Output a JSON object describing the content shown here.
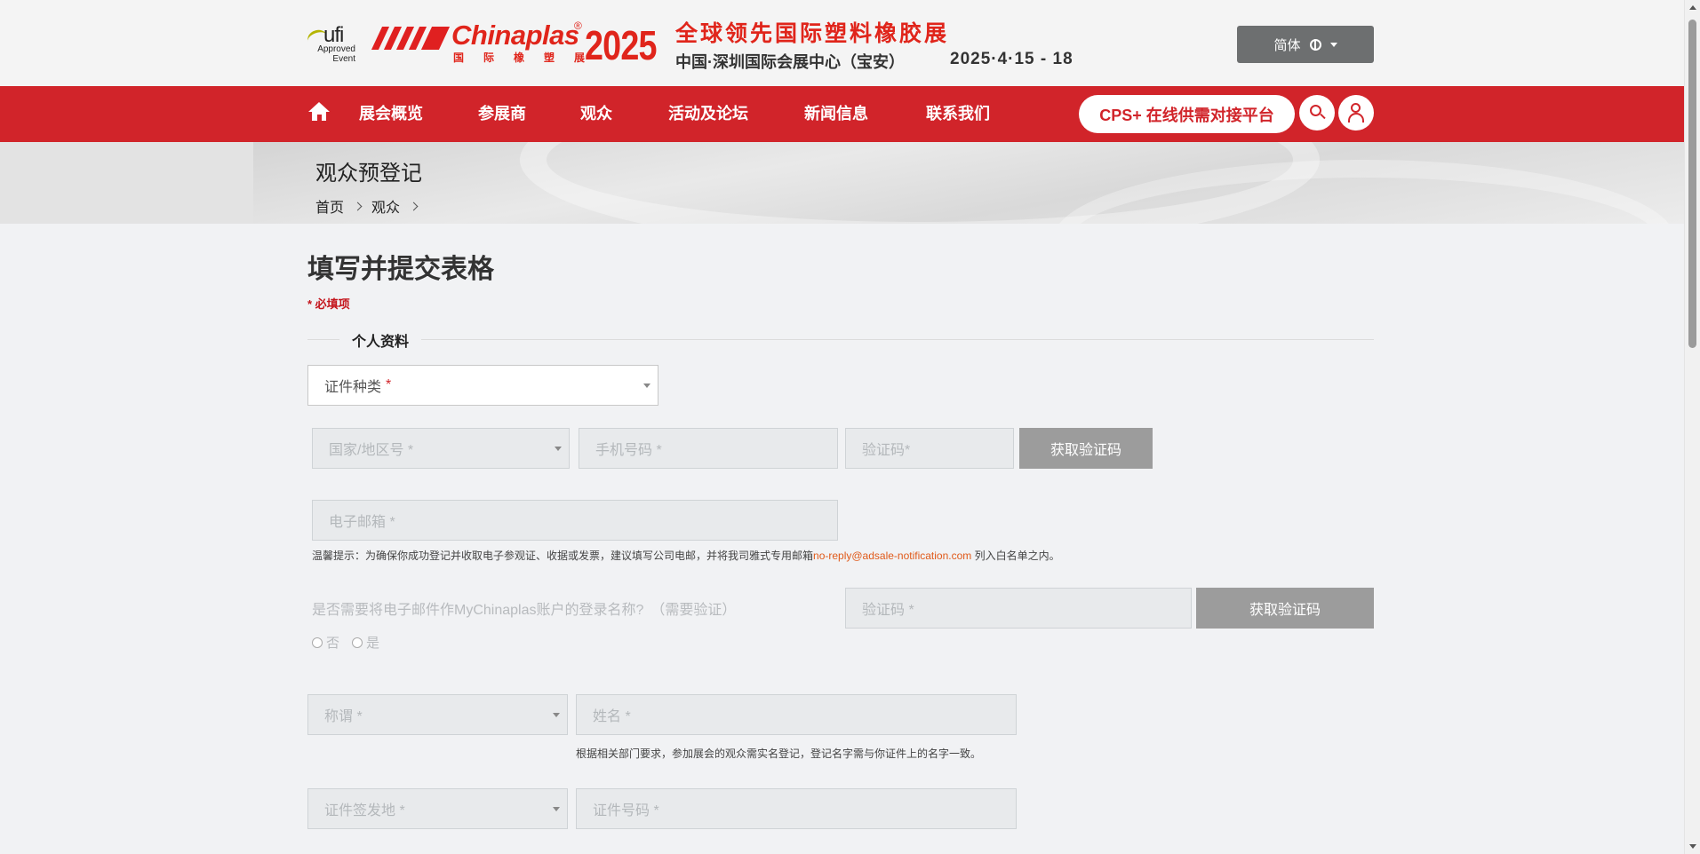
{
  "header": {
    "ufi": {
      "mark": "ufi",
      "sub": "Approved Event"
    },
    "logo": {
      "brand": "Chinaplas",
      "reg": "®",
      "year": "2025",
      "cn_small": "国际橡塑展"
    },
    "tagline": "全球领先国际塑料橡胶展",
    "venue": "中国·深圳国际会展中心（宝安）",
    "dates": "2025·4·15 - 18",
    "language": "简体"
  },
  "nav": {
    "items": [
      "展会概览",
      "参展商",
      "观众",
      "活动及论坛",
      "新闻信息",
      "联系我们"
    ],
    "cps_label": "CPS+ 在线供需对接平台"
  },
  "banner": {
    "title": "观众预登记",
    "breadcrumb": [
      "首页",
      "观众"
    ]
  },
  "form": {
    "title": "填写并提交表格",
    "required_note": "* 必填项",
    "section_label": "个人资料",
    "id_type": "证件种类",
    "country_code": "国家/地区号 *",
    "mobile": "手机号码 *",
    "sms_code": "验证码*",
    "get_code_label": "获取验证码",
    "email": "电子邮箱 *",
    "email_hint_prefix": "温馨提示：为确保你成功登记并收取电子参观证、收据或发票，建议填写公司电邮，并将我司雅式专用邮箱",
    "email_hint_link": "no-reply@adsale-notification.com",
    "email_hint_suffix": " 列入白名单之内。",
    "login_question": "是否需要将电子邮件作MyChinaplas账户的登录名称?　（需要验证）",
    "radio_no": "否",
    "radio_yes": "是",
    "email_code": "验证码 *",
    "get_code_label_2": "获取验证码",
    "salutation": "称谓 *",
    "name": "姓名 *",
    "name_hint": "根据相关部门要求，参加展会的观众需实名登记，登记名字需与你证件上的名字一致。",
    "id_issue_place": "证件签发地 *",
    "id_number": "证件号码 *"
  },
  "colors": {
    "brand_red": "#d1242a",
    "logo_red": "#e0251b",
    "link_orange": "#e05a1a"
  }
}
